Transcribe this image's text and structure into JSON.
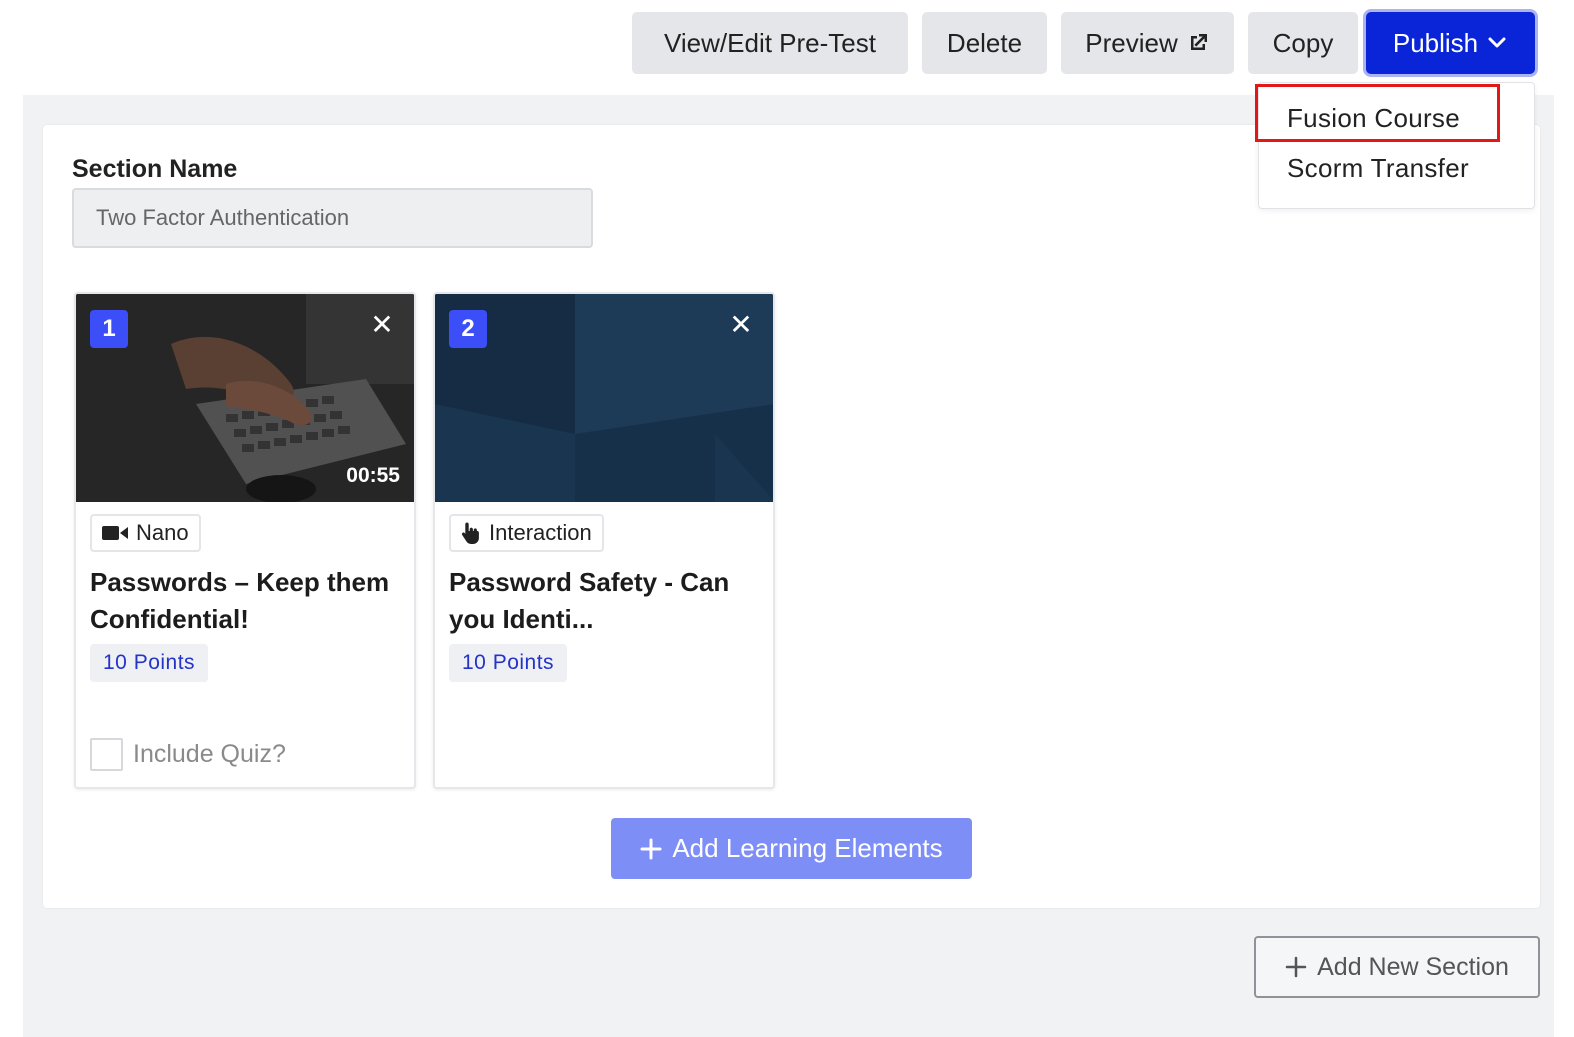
{
  "toolbar": {
    "view_edit_pretest": "View/Edit Pre-Test",
    "delete": "Delete",
    "preview": "Preview",
    "copy": "Copy",
    "publish": "Publish"
  },
  "publish_menu": {
    "items": [
      "Fusion Course",
      "Scorm Transfer"
    ],
    "highlighted_item": "Fusion Course"
  },
  "section": {
    "label": "Section Name",
    "value": "Two Factor Authentication"
  },
  "cards": [
    {
      "number": "1",
      "duration": "00:55",
      "type": "Nano",
      "type_icon": "video-camera-icon",
      "title": "Passwords – Keep them Confidential!",
      "points": "10 Points",
      "quiz_label": "Include Quiz?"
    },
    {
      "number": "2",
      "type": "Interaction",
      "type_icon": "pointer-hand-icon",
      "title": "Password Safety - Can you Identi...",
      "points": "10 Points"
    }
  ],
  "actions": {
    "add_learning_elements": "Add Learning Elements",
    "add_new_section": "Add New Section"
  },
  "colors": {
    "primary": "#0a24d8",
    "badge": "#3b4ef8",
    "add_button": "#7e8ef7",
    "highlight": "#e01818"
  }
}
